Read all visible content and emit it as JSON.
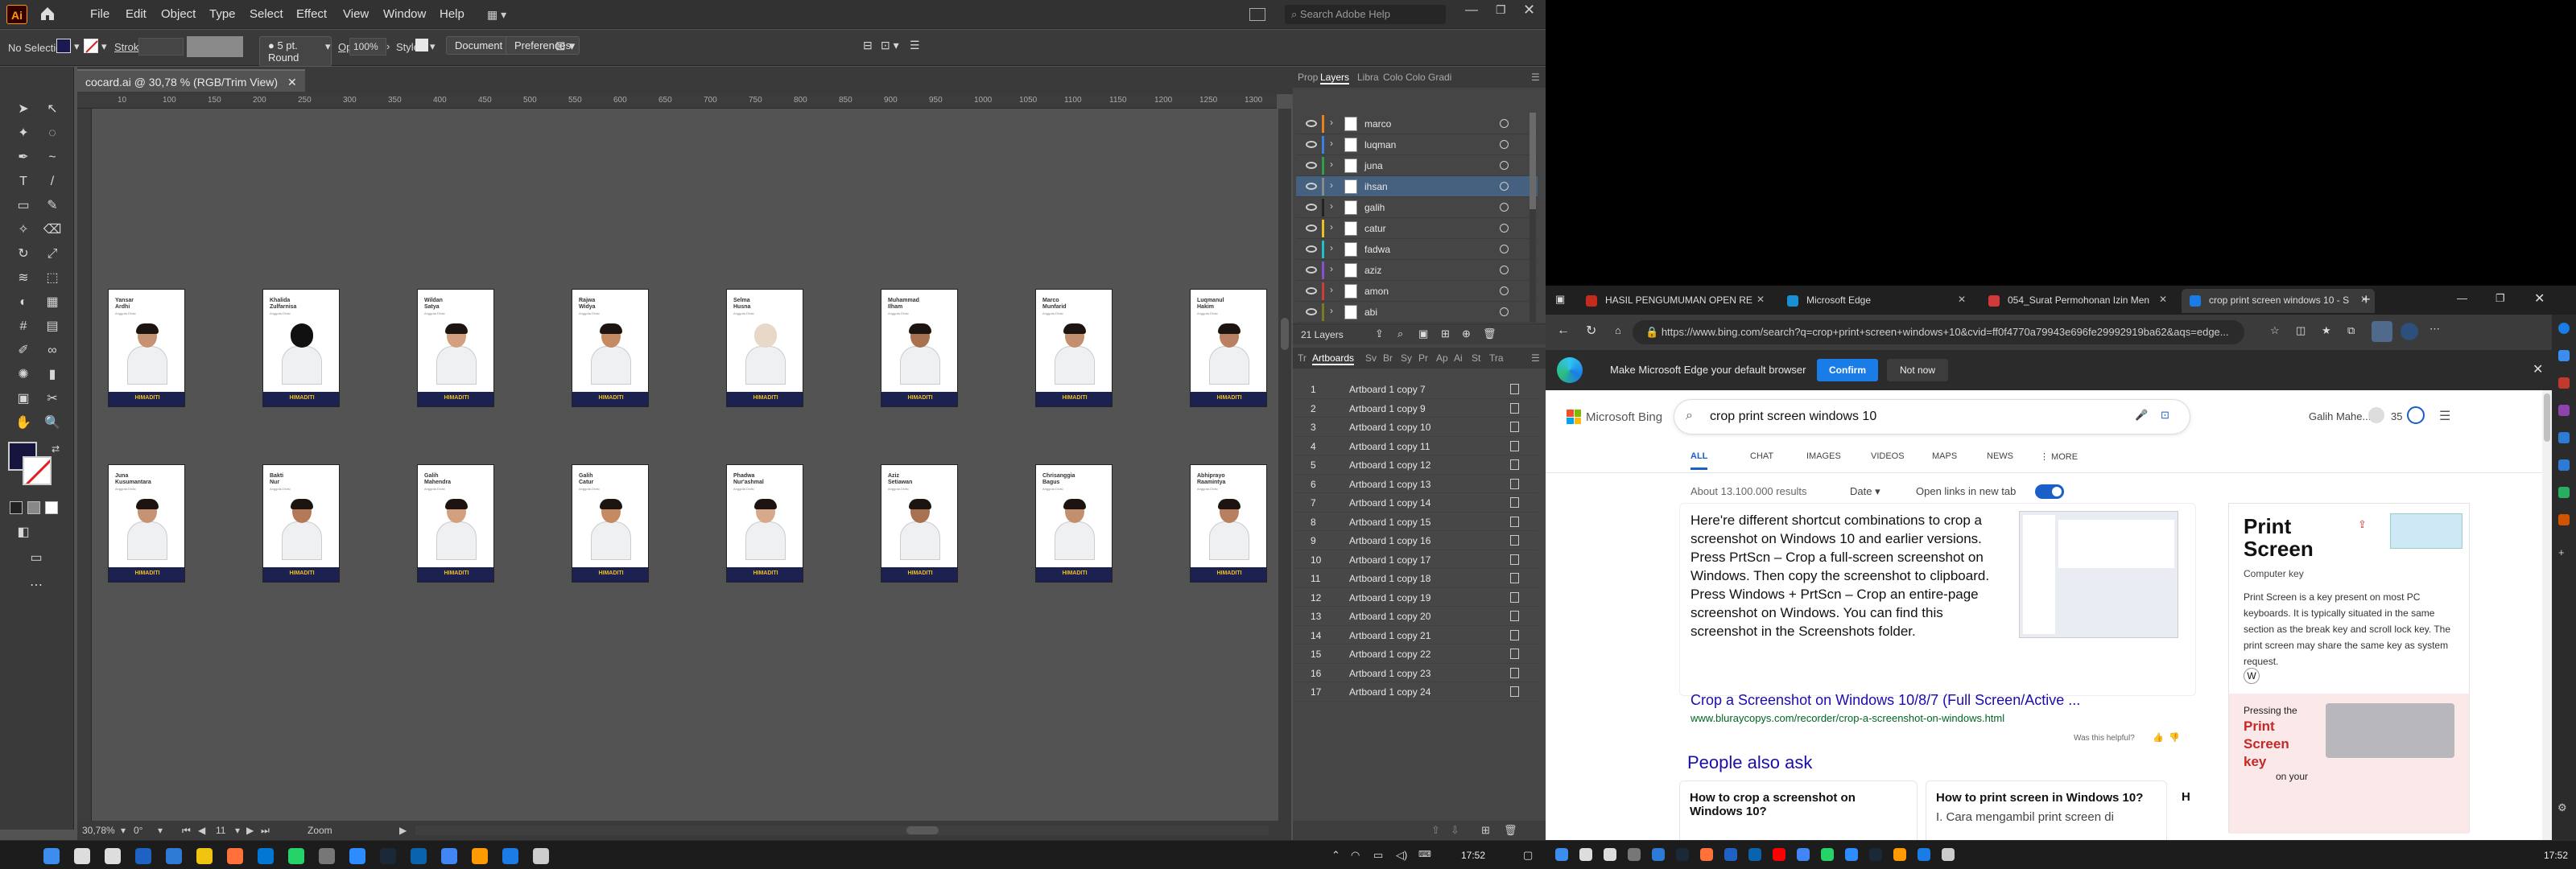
{
  "illustrator": {
    "menu": [
      "File",
      "Edit",
      "Object",
      "Type",
      "Select",
      "Effect",
      "View",
      "Window",
      "Help"
    ],
    "search_placeholder": "Search Adobe Help",
    "control": {
      "selection": "No Selection",
      "stroke_label": "Stroke:",
      "brush": "5 pt. Round",
      "opacity_label": "Opacity:",
      "opacity_value": "100%",
      "style_label": "Style:",
      "document_setup": "Document Setup",
      "preferences": "Preferences"
    },
    "doc_tab": "cocard.ai @ 30,78 % (RGB/Trim View)",
    "ruler_marks": [
      "10",
      "100",
      "150",
      "200",
      "250",
      "300",
      "350",
      "400",
      "450",
      "500",
      "550",
      "600",
      "650",
      "700",
      "750",
      "800",
      "850",
      "900",
      "950",
      "1000",
      "1050",
      "1100",
      "1150",
      "1200",
      "1250",
      "1300"
    ],
    "cards_top": [
      {
        "name": "Yansar\nArdhi",
        "role": "Anggota Divisi"
      },
      {
        "name": "Khalida\nZulfarnisa",
        "role": "Anggota Divisi"
      },
      {
        "name": "Wildan\nSatya",
        "role": "Anggota Divisi"
      },
      {
        "name": "Rajwa\nWidya",
        "role": "Anggota Divisi"
      },
      {
        "name": "Selma\nHusna",
        "role": "Anggota Divisi"
      },
      {
        "name": "Muhammad\nIlham",
        "role": "Anggota Divisi"
      },
      {
        "name": "Marco\nMunfarid",
        "role": "Anggota Divisi"
      },
      {
        "name": "Luqmanul\nHakim",
        "role": "Anggota Divisi"
      }
    ],
    "cards_bottom": [
      {
        "name": "Juna\nKusumantara",
        "role": "Anggota Divisi"
      },
      {
        "name": "Bakti\nNur",
        "role": "Anggota Divisi"
      },
      {
        "name": "Galih\nMahendra",
        "role": "Anggota Divisi"
      },
      {
        "name": "Galih\nCatur",
        "role": "Anggota Divisi"
      },
      {
        "name": "Phadwa\nNur'ashmal",
        "role": "Anggota Divisi"
      },
      {
        "name": "Aziz\nSetiawan",
        "role": "Anggota Divisi"
      },
      {
        "name": "Chrisanggia\nBagus",
        "role": "Anggota Divisi"
      },
      {
        "name": "Abhiprayo\nRaamintya",
        "role": "Anggota Divisi"
      }
    ],
    "card_footer": "HIMADITI",
    "status": {
      "zoom": "30,78%",
      "rotation": "0°",
      "artboard": "11",
      "mode": "Zoom"
    },
    "layers_tabs": [
      "Prop",
      "Layers",
      "Libra",
      "Colo",
      "Colo",
      "Gradi"
    ],
    "layers": [
      {
        "name": "marco",
        "color": "#e8821e"
      },
      {
        "name": "luqman",
        "color": "#3b7fe0"
      },
      {
        "name": "juna",
        "color": "#2fa04a"
      },
      {
        "name": "ihsan",
        "color": "#8a8a8a",
        "selected": true
      },
      {
        "name": "galih",
        "color": "#222222"
      },
      {
        "name": "catur",
        "color": "#e8c020"
      },
      {
        "name": "fadwa",
        "color": "#22c0c8"
      },
      {
        "name": "aziz",
        "color": "#8a4fd0"
      },
      {
        "name": "amon",
        "color": "#d03a3a"
      },
      {
        "name": "abi",
        "color": "#7a7a20"
      }
    ],
    "layers_count": "21 Layers",
    "artboards_tabs": [
      "Tr",
      "Artboards",
      "Sv",
      "Br",
      "Sy",
      "Pr",
      "Ap",
      "Ai",
      "St",
      "Tra"
    ],
    "artboards": [
      {
        "n": "1",
        "t": "Artboard 1 copy 7"
      },
      {
        "n": "2",
        "t": "Artboard 1 copy 9"
      },
      {
        "n": "3",
        "t": "Artboard 1 copy 10"
      },
      {
        "n": "4",
        "t": "Artboard 1 copy 11"
      },
      {
        "n": "5",
        "t": "Artboard 1 copy 12"
      },
      {
        "n": "6",
        "t": "Artboard 1 copy 13"
      },
      {
        "n": "7",
        "t": "Artboard 1 copy 14"
      },
      {
        "n": "8",
        "t": "Artboard 1 copy 15"
      },
      {
        "n": "9",
        "t": "Artboard 1 copy 16"
      },
      {
        "n": "10",
        "t": "Artboard 1 copy 17"
      },
      {
        "n": "11",
        "t": "Artboard 1 copy 18"
      },
      {
        "n": "12",
        "t": "Artboard 1 copy 19"
      },
      {
        "n": "13",
        "t": "Artboard 1 copy 20"
      },
      {
        "n": "14",
        "t": "Artboard 1 copy 21"
      },
      {
        "n": "15",
        "t": "Artboard 1 copy 22"
      },
      {
        "n": "16",
        "t": "Artboard 1 copy 23"
      },
      {
        "n": "17",
        "t": "Artboard 1 copy 24"
      }
    ]
  },
  "edge": {
    "tabs": [
      {
        "title": "HASIL PENGUMUMAN OPEN RE",
        "color": "#c42b1c"
      },
      {
        "title": "Microsoft Edge",
        "color": "#1a8fd6"
      },
      {
        "title": "054_Surat Permohonan Izin Men",
        "color": "#d03a3a"
      },
      {
        "title": "crop print screen windows 10 - S",
        "color": "#1a7ce6",
        "active": true
      }
    ],
    "url": "https://www.bing.com/search?q=crop+print+screen+windows+10&cvid=ff0f4770a79943e696fe29992919ba62&aqs=edge...",
    "banner_text": "Make Microsoft Edge your default browser",
    "confirm": "Confirm",
    "not_now": "Not now",
    "bing": {
      "logo": "Microsoft Bing",
      "query": "crop print screen windows 10",
      "user": "Galih Mahe...",
      "points": "35",
      "nav": [
        "ALL",
        "CHAT",
        "IMAGES",
        "VIDEOS",
        "MAPS",
        "NEWS",
        "⋮ MORE"
      ],
      "results_count": "About 13.100.000 results",
      "date_filter": "Date ▾",
      "open_new_tab": "Open links in new tab",
      "answer": "Here're different shortcut combinations to crop a screenshot on Windows 10 and earlier versions. Press PrtScn – Crop a full-screen screenshot on Windows. Then copy the screenshot to clipboard. Press Windows + PrtScn – Crop an entire-page screenshot on Windows. You can find this screenshot in the Screenshots folder.",
      "result_title": "Crop a Screenshot on Windows 10/8/7 (Full Screen/Active ...",
      "result_url": "www.bluraycopys.com/recorder/crop-a-screenshot-on-windows.html",
      "helpful": "Was this helpful?",
      "paa_title": "People also ask",
      "paa": [
        "How to crop a screenshot on Windows 10?",
        "How to print screen in Windows 10?",
        "H"
      ],
      "paa_snippet": "I. Cara mengambil print screen di",
      "side_title": "Print Screen",
      "side_subtitle": "Computer key",
      "side_desc": "Print Screen is a key present on most PC keyboards. It is typically situated in the same section as the break key and scroll lock key. The print screen may share the same key as system request.",
      "pressing_label": "Pressing the",
      "pressing_key": "Print Screen key",
      "pressing_tail": "on your"
    }
  },
  "taskbar_left": {
    "time": "17:52"
  },
  "taskbar_right": {
    "time": "17:52"
  }
}
